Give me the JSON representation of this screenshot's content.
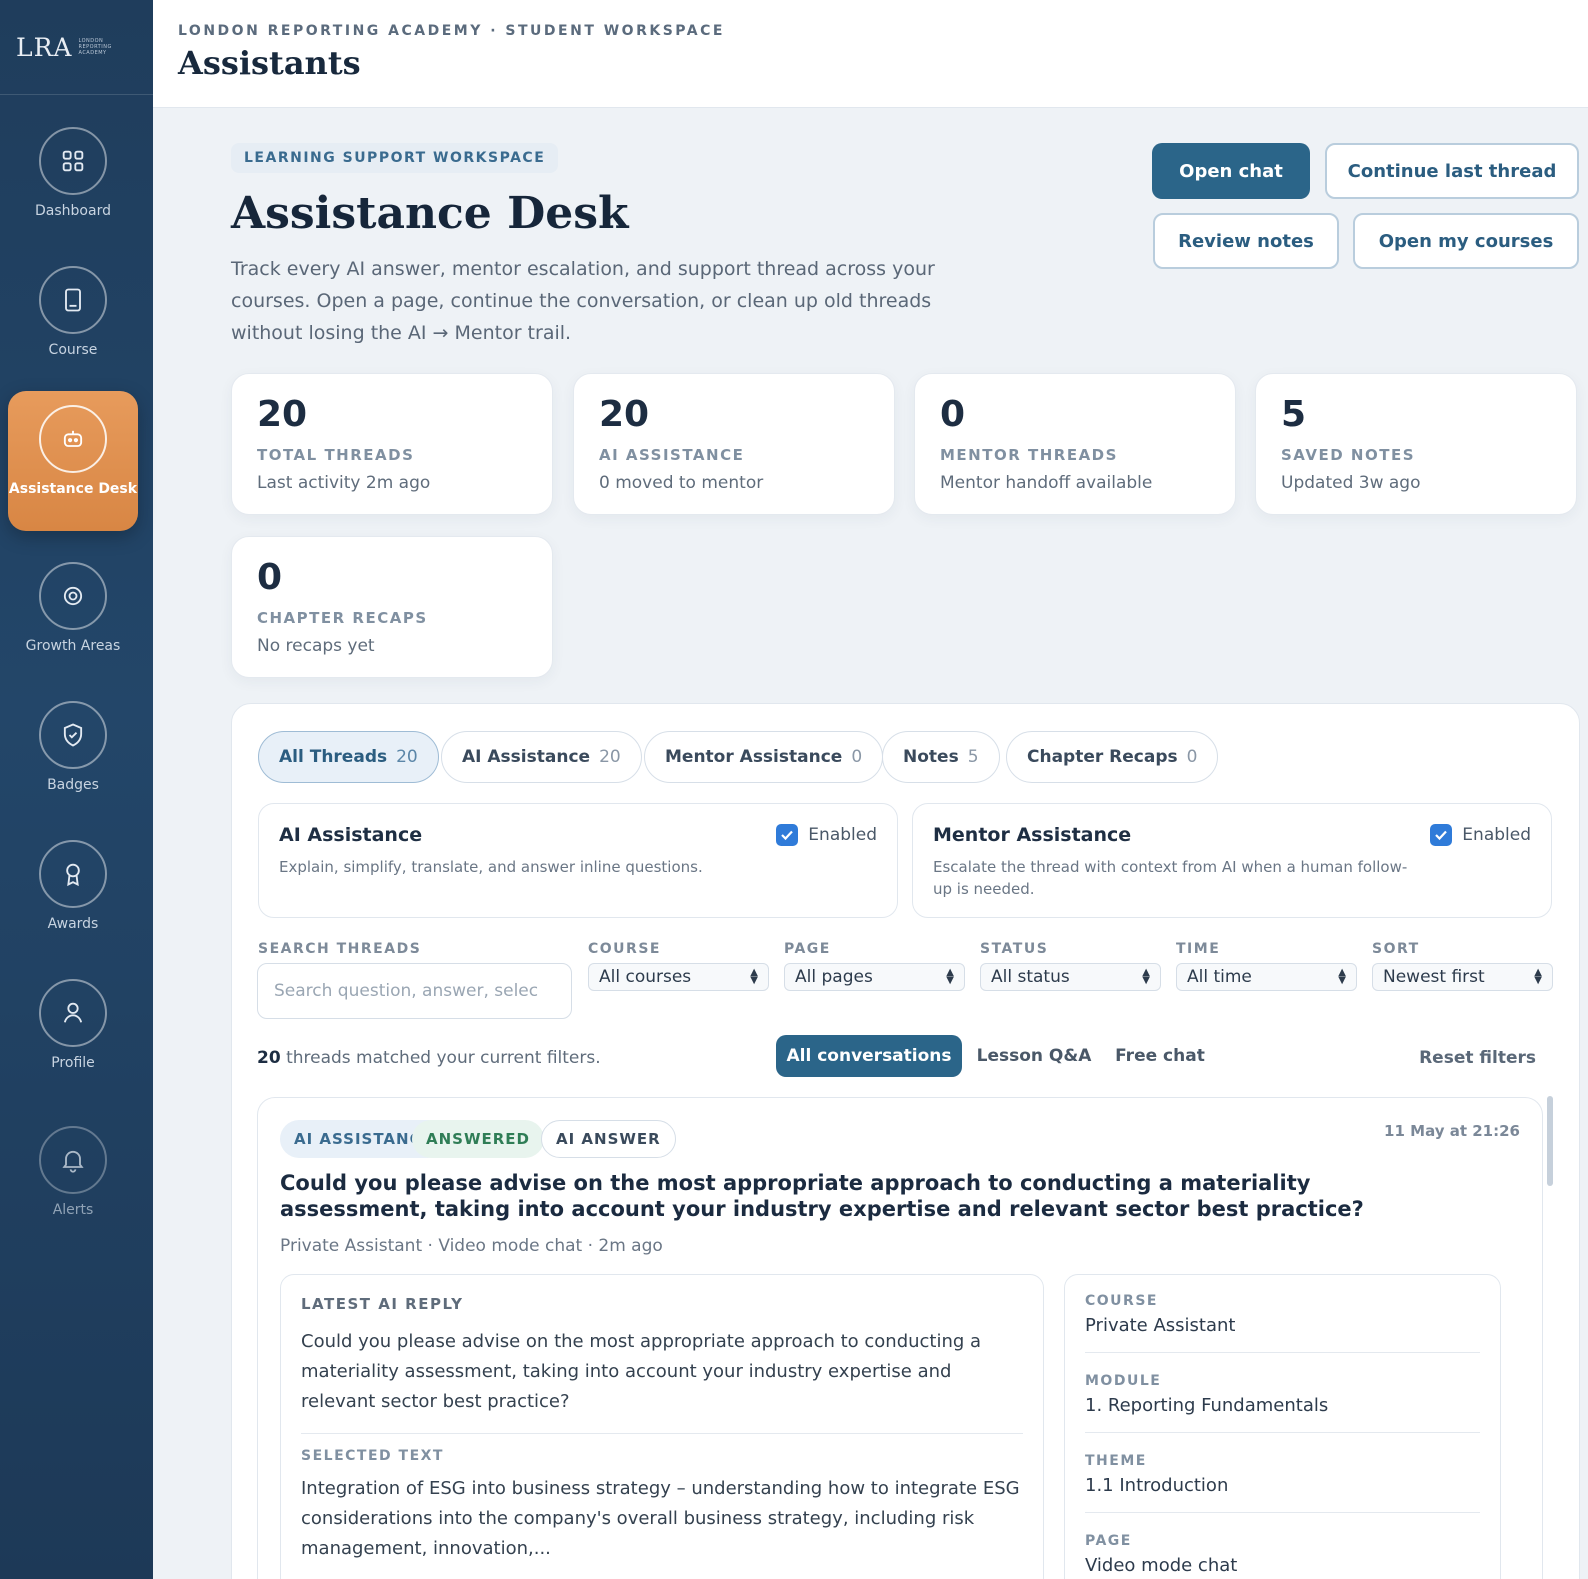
{
  "logo": {
    "main": "LRA",
    "sub": "LONDON REPORTING ACADEMY"
  },
  "sidebar": {
    "items": [
      {
        "label": "Dashboard",
        "icon": "grid-icon"
      },
      {
        "label": "Course",
        "icon": "tablet-icon"
      },
      {
        "label": "Assistance Desk",
        "icon": "robot-icon",
        "active": true
      },
      {
        "label": "Growth Areas",
        "icon": "target-icon"
      },
      {
        "label": "Badges",
        "icon": "shield-check-icon"
      },
      {
        "label": "Awards",
        "icon": "ribbon-icon"
      },
      {
        "label": "Profile",
        "icon": "user-icon"
      },
      {
        "label": "Alerts",
        "icon": "bell-icon"
      }
    ]
  },
  "header": {
    "eyebrow": "LONDON REPORTING ACADEMY · STUDENT WORKSPACE",
    "title": "Assistants"
  },
  "hero": {
    "chip": "LEARNING SUPPORT WORKSPACE",
    "title": "Assistance Desk",
    "description": "Track every AI answer, mentor escalation, and support thread across your courses. Open a page, continue the conversation, or clean up old threads without losing the AI → Mentor trail.",
    "buttons": {
      "open_chat": "Open chat",
      "continue": "Continue last thread",
      "review_notes": "Review notes",
      "open_courses": "Open my courses"
    }
  },
  "stats": [
    {
      "value": "20",
      "label": "TOTAL THREADS",
      "sub": "Last activity 2m ago"
    },
    {
      "value": "20",
      "label": "AI ASSISTANCE",
      "sub": "0 moved to mentor"
    },
    {
      "value": "0",
      "label": "MENTOR THREADS",
      "sub": "Mentor handoff available"
    },
    {
      "value": "5",
      "label": "SAVED NOTES",
      "sub": "Updated 3w ago"
    },
    {
      "value": "0",
      "label": "CHAPTER RECAPS",
      "sub": "No recaps yet"
    }
  ],
  "tabs": [
    {
      "label": "All Threads",
      "count": "20"
    },
    {
      "label": "AI Assistance",
      "count": "20"
    },
    {
      "label": "Mentor Assistance",
      "count": "0"
    },
    {
      "label": "Notes",
      "count": "5"
    },
    {
      "label": "Chapter Recaps",
      "count": "0"
    }
  ],
  "toggles": [
    {
      "title": "AI Assistance",
      "desc": "Explain, simplify, translate, and answer inline questions.",
      "state": "Enabled"
    },
    {
      "title": "Mentor Assistance",
      "desc": "Escalate the thread with context from AI when a human follow-up is needed.",
      "state": "Enabled"
    }
  ],
  "filters": {
    "search_label": "SEARCH THREADS",
    "search_placeholder": "Search question, answer, selec",
    "course_label": "COURSE",
    "course_value": "All courses",
    "page_label": "PAGE",
    "page_value": "All pages",
    "status_label": "STATUS",
    "status_value": "All status",
    "time_label": "TIME",
    "time_value": "All time",
    "sort_label": "SORT",
    "sort_value": "Newest first"
  },
  "results": {
    "count": "20",
    "text": " threads matched your current filters.",
    "segments": [
      "All conversations",
      "Lesson Q&A",
      "Free chat"
    ],
    "reset": "Reset filters"
  },
  "thread": {
    "badges": [
      "AI ASSISTANCE",
      "ANSWERED",
      "AI ANSWER"
    ],
    "date": "11 May at 21:26",
    "question": "Could you please advise on the most appropriate approach to conducting a materiality assessment, taking into account your industry expertise and relevant sector best practice?",
    "meta": "Private Assistant · Video mode chat · 2m ago",
    "reply_label": "LATEST AI REPLY",
    "reply_text": "Could you please advise on the most appropriate approach to conducting a materiality assessment, taking into account your industry expertise and relevant sector best practice?",
    "selected_label": "SELECTED TEXT",
    "selected_text": "Integration of ESG into business strategy – understanding how to integrate ESG considerations into the company's overall business strategy, including risk management, innovation,...",
    "info": [
      {
        "k": "COURSE",
        "v": "Private Assistant"
      },
      {
        "k": "MODULE",
        "v": "1. Reporting Fundamentals"
      },
      {
        "k": "THEME",
        "v": "1.1 Introduction"
      },
      {
        "k": "PAGE",
        "v": "Video mode chat"
      }
    ]
  }
}
